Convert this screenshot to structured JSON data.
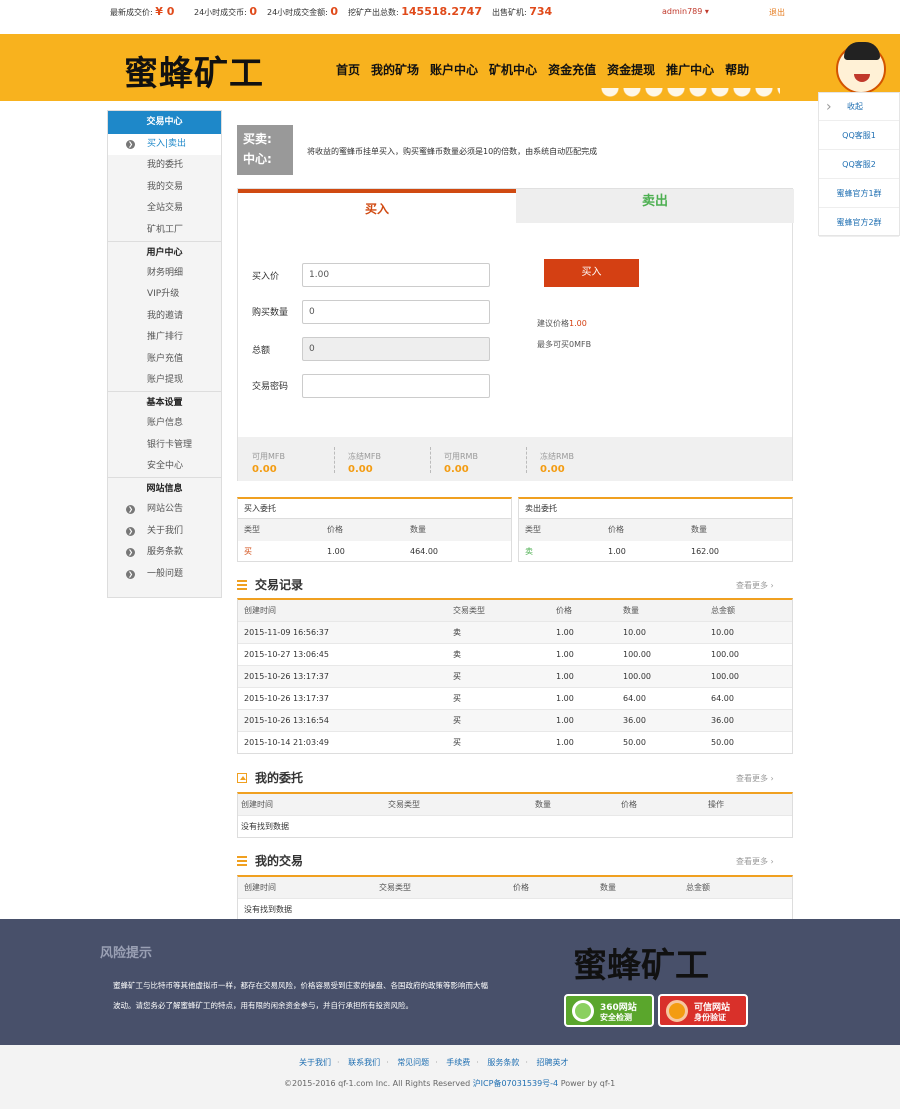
{
  "topbar": {
    "stats": [
      {
        "label": "最新成交价:",
        "value": "¥ 0"
      },
      {
        "label": "24小时成交币:",
        "value": "0"
      },
      {
        "label": "24小时成交金额:",
        "value": "0"
      },
      {
        "label": "挖矿产出总数:",
        "value": "145518.2747"
      },
      {
        "label": "出售矿机:",
        "value": "734"
      }
    ],
    "user": "admin789",
    "logout": "退出"
  },
  "header": {
    "logo": "蜜蜂矿工",
    "nav": [
      "首页",
      "我的矿场",
      "账户中心",
      "矿机中心",
      "资金充值",
      "资金提现",
      "推广中心",
      "帮助"
    ]
  },
  "float": {
    "collapse": "收起",
    "items": [
      "QQ客服1",
      "QQ客服2",
      "蜜蜂官方1群",
      "蜜蜂官方2群"
    ]
  },
  "sidebar": {
    "title": "交易中心",
    "trade_items": [
      "买入|卖出",
      "我的委托",
      "我的交易",
      "全站交易",
      "矿机工厂"
    ],
    "user_title": "用户中心",
    "user_items": [
      "财务明细",
      "VIP升级",
      "我的邀请",
      "推广排行",
      "账户充值",
      "账户提现"
    ],
    "basic_title": "基本设置",
    "basic_items": [
      "账户信息",
      "银行卡管理",
      "安全中心"
    ],
    "site_title": "网站信息",
    "site_items": [
      "网站公告",
      "关于我们",
      "服务条款",
      "一般问题"
    ]
  },
  "trade": {
    "label_line1": "买卖:",
    "label_line2": "中心:",
    "desc": "将收益的蜜蜂币挂单买入，购买蜜蜂币数量必须是10的倍数，由系统自动匹配完成",
    "tab_buy": "买入",
    "tab_sell": "卖出",
    "price_label": "买入价",
    "price_value": "1.00",
    "qty_label": "购买数量",
    "qty_value": "0",
    "total_label": "总额",
    "total_value": "0",
    "pwd_label": "交易密码",
    "buy_button": "买入",
    "advice_prefix": "建议价格",
    "advice_price": "1.00",
    "max_text": "最多可买0MFB"
  },
  "balances": [
    {
      "label": "可用MFB",
      "value": "0.00"
    },
    {
      "label": "冻结MFB",
      "value": "0.00"
    },
    {
      "label": "可用RMB",
      "value": "0.00"
    },
    {
      "label": "冻结RMB",
      "value": "0.00"
    }
  ],
  "buy_orders": {
    "title": "买入委托",
    "headers": [
      "类型",
      "价格",
      "数量"
    ],
    "row": [
      "买",
      "1.00",
      "464.00"
    ]
  },
  "sell_orders": {
    "title": "卖出委托",
    "headers": [
      "类型",
      "价格",
      "数量"
    ],
    "row": [
      "卖",
      "1.00",
      "162.00"
    ]
  },
  "records": {
    "title": "交易记录",
    "more": "查看更多",
    "headers": [
      "创建时间",
      "交易类型",
      "价格",
      "数量",
      "总金额"
    ],
    "rows": [
      [
        "2015-11-09 16:56:37",
        "卖",
        "1.00",
        "10.00",
        "10.00"
      ],
      [
        "2015-10-27 13:06:45",
        "卖",
        "1.00",
        "100.00",
        "100.00"
      ],
      [
        "2015-10-26 13:17:37",
        "买",
        "1.00",
        "100.00",
        "100.00"
      ],
      [
        "2015-10-26 13:17:37",
        "买",
        "1.00",
        "64.00",
        "64.00"
      ],
      [
        "2015-10-26 13:16:54",
        "买",
        "1.00",
        "36.00",
        "36.00"
      ],
      [
        "2015-10-14 21:03:49",
        "买",
        "1.00",
        "50.00",
        "50.00"
      ]
    ]
  },
  "my_orders": {
    "title": "我的委托",
    "more": "查看更多",
    "headers": [
      "创建时间",
      "交易类型",
      "数量",
      "价格",
      "操作"
    ],
    "empty": "没有找到数据"
  },
  "my_trades": {
    "title": "我的交易",
    "more": "查看更多",
    "headers": [
      "创建时间",
      "交易类型",
      "价格",
      "数量",
      "总金额"
    ],
    "empty": "没有找到数据"
  },
  "footer": {
    "risk_title": "风险提示",
    "risk_line1": "蜜蜂矿工与比特币等其他虚拟币一样，都存在交易风险，价格容易受到庄家的操盘、各国政府的政策等影响而大幅",
    "risk_line2": "波动。请您务必了解蜜蜂矿工的特点，用有限的闲余资金参与，并自行承担所有投资风险。",
    "logo": "蜜蜂矿工",
    "badge1_line1": "360网站",
    "badge1_line2": "安全检测",
    "badge2_line1": "可信网站",
    "badge2_line2": "身份验证",
    "links": [
      "关于我们",
      "联系我们",
      "常见问题",
      "手续费",
      "服务条款",
      "招聘英才"
    ],
    "copyright": "©2015-2016 qf-1.com Inc. All Rights Reserved ",
    "icp": "沪ICP备07031539号-4",
    "powered": " Power by qf-1"
  }
}
